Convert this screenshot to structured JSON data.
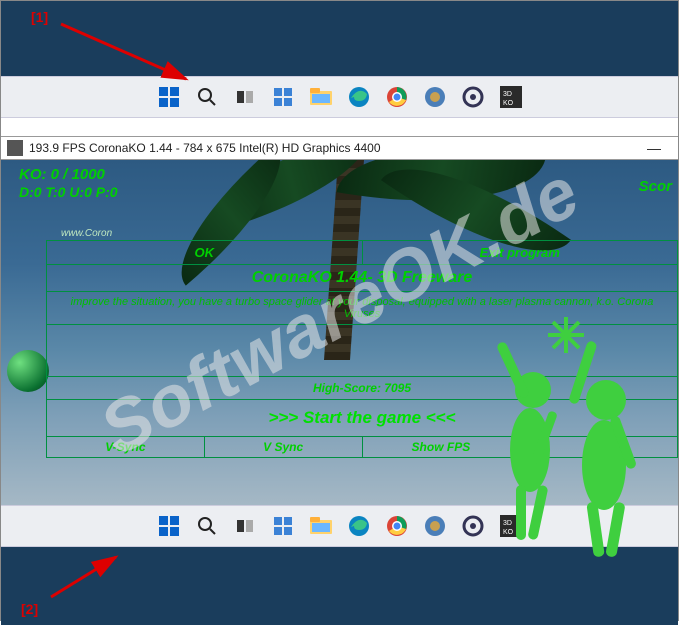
{
  "annotations": {
    "top": "[1]",
    "bottom": "[2]"
  },
  "taskbar_tooltip": "Windows taskbar",
  "window": {
    "title": "193.9 FPS CoronaKO 1.44 - 784 x 675 Intel(R) HD Graphics 4400",
    "minimize": "—"
  },
  "hud": {
    "ko": "KO: 0 / 1000",
    "stats": "D:0 T:0 U:0 P:0",
    "score": "Scor"
  },
  "menu": {
    "ok": "OK",
    "exit": "Exit program",
    "title": "CoronaKO 1.44- 3D Freeware",
    "desc": "improve the situation, you have a turbo space glider at your disposal, equipped with a laser plasma cannon, k.o. Corona Viruses",
    "highscore": "High-Score: 7095",
    "start": ">>> Start the game <<<",
    "opt1": "V-Sync",
    "opt2": "V Sync",
    "opt3": "Show FPS",
    "opt4": "..."
  },
  "watermark": "SoftwareOK.de",
  "small_text": "www.Coron"
}
